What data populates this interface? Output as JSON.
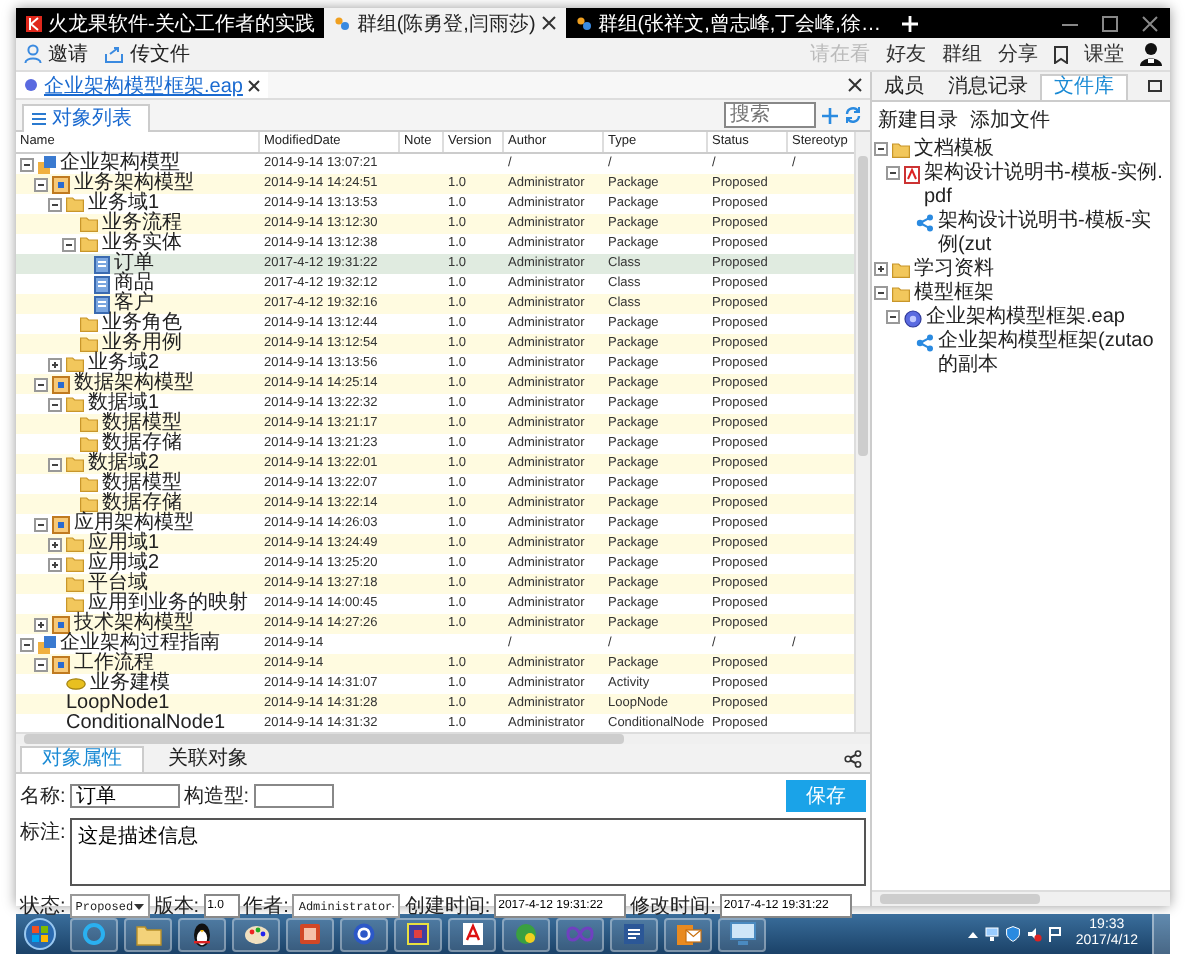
{
  "title_bar": {
    "tabs": [
      {
        "label": "火龙果软件-关心工作者的实践",
        "selected": false
      },
      {
        "label": "群组(陈勇登,闫雨莎)",
        "selected": true
      },
      {
        "label": "群组(张祥文,曾志峰,丁会峰,徐…",
        "selected": false
      }
    ]
  },
  "toolbar": {
    "left": [
      {
        "label": "邀请",
        "kind": "invite"
      },
      {
        "label": "传文件",
        "kind": "upload"
      }
    ],
    "right": [
      {
        "label": "请在看",
        "disabled": true
      },
      {
        "label": "好友",
        "disabled": false
      },
      {
        "label": "群组",
        "disabled": false
      },
      {
        "label": "分享",
        "disabled": false
      },
      {
        "label": "课堂",
        "disabled": false
      }
    ]
  },
  "document_tab": {
    "label": "企业架构模型框架.eap"
  },
  "object_list": {
    "tab": "对象列表",
    "search": {
      "placeholder": "搜索"
    },
    "columns": [
      "Name",
      "ModifiedDate",
      "Note",
      "Version",
      "Author",
      "Type",
      "Status",
      "Stereotyp"
    ],
    "rows": [
      {
        "name": "企业架构模型",
        "kind": "model",
        "modified": "2014-9-14 13:07:21",
        "author": "/",
        "type": "/",
        "status": "/",
        "stereotype": "/",
        "expanded": true,
        "selected": false,
        "children": [
          {
            "name": "业务架构模型",
            "kind": "package",
            "modified": "2014-9-14 14:24:51",
            "version": "1.0",
            "author": "Administrator",
            "type": "Package",
            "status": "Proposed",
            "expanded": true,
            "selected": false,
            "children": [
              {
                "name": "业务域1",
                "kind": "folder",
                "modified": "2014-9-14 13:13:53",
                "version": "1.0",
                "author": "Administrator",
                "type": "Package",
                "status": "Proposed",
                "expanded": true,
                "selected": false,
                "children": [
                  {
                    "name": "业务流程",
                    "kind": "folder",
                    "modified": "2014-9-14 13:12:30",
                    "version": "1.0",
                    "author": "Administrator",
                    "type": "Package",
                    "status": "Proposed",
                    "selected": false
                  },
                  {
                    "name": "业务实体",
                    "kind": "folder",
                    "modified": "2014-9-14 13:12:38",
                    "version": "1.0",
                    "author": "Administrator",
                    "type": "Package",
                    "status": "Proposed",
                    "expanded": true,
                    "selected": false,
                    "children": [
                      {
                        "name": "订单",
                        "kind": "class",
                        "modified": "2017-4-12 19:31:22",
                        "version": "1.0",
                        "author": "Administrator",
                        "type": "Class",
                        "status": "Proposed",
                        "selected": true
                      },
                      {
                        "name": "商品",
                        "kind": "class",
                        "modified": "2017-4-12 19:32:12",
                        "version": "1.0",
                        "author": "Administrator",
                        "type": "Class",
                        "status": "Proposed",
                        "selected": false
                      },
                      {
                        "name": "客户",
                        "kind": "class",
                        "modified": "2017-4-12 19:32:16",
                        "version": "1.0",
                        "author": "Administrator",
                        "type": "Class",
                        "status": "Proposed",
                        "selected": false
                      }
                    ]
                  },
                  {
                    "name": "业务角色",
                    "kind": "folder",
                    "modified": "2014-9-14 13:12:44",
                    "version": "1.0",
                    "author": "Administrator",
                    "type": "Package",
                    "status": "Proposed",
                    "selected": false
                  },
                  {
                    "name": "业务用例",
                    "kind": "folder",
                    "modified": "2014-9-14 13:12:54",
                    "version": "1.0",
                    "author": "Administrator",
                    "type": "Package",
                    "status": "Proposed",
                    "selected": false
                  }
                ]
              },
              {
                "name": "业务域2",
                "kind": "folder",
                "modified": "2014-9-14 13:13:56",
                "version": "1.0",
                "author": "Administrator",
                "type": "Package",
                "status": "Proposed",
                "expanded": false,
                "selected": false
              }
            ]
          },
          {
            "name": "数据架构模型",
            "kind": "package",
            "modified": "2014-9-14 14:25:14",
            "version": "1.0",
            "author": "Administrator",
            "type": "Package",
            "status": "Proposed",
            "expanded": true,
            "selected": false,
            "children": [
              {
                "name": "数据域1",
                "kind": "folder",
                "modified": "2014-9-14 13:22:32",
                "version": "1.0",
                "author": "Administrator",
                "type": "Package",
                "status": "Proposed",
                "expanded": true,
                "selected": false,
                "children": [
                  {
                    "name": "数据模型",
                    "kind": "folder",
                    "modified": "2014-9-14 13:21:17",
                    "version": "1.0",
                    "author": "Administrator",
                    "type": "Package",
                    "status": "Proposed",
                    "selected": false
                  },
                  {
                    "name": "数据存储",
                    "kind": "folder",
                    "modified": "2014-9-14 13:21:23",
                    "version": "1.0",
                    "author": "Administrator",
                    "type": "Package",
                    "status": "Proposed",
                    "selected": false
                  }
                ]
              },
              {
                "name": "数据域2",
                "kind": "folder",
                "modified": "2014-9-14 13:22:01",
                "version": "1.0",
                "author": "Administrator",
                "type": "Package",
                "status": "Proposed",
                "expanded": true,
                "selected": false,
                "children": [
                  {
                    "name": "数据模型",
                    "kind": "folder",
                    "modified": "2014-9-14 13:22:07",
                    "version": "1.0",
                    "author": "Administrator",
                    "type": "Package",
                    "status": "Proposed",
                    "selected": false
                  },
                  {
                    "name": "数据存储",
                    "kind": "folder",
                    "modified": "2014-9-14 13:22:14",
                    "version": "1.0",
                    "author": "Administrator",
                    "type": "Package",
                    "status": "Proposed",
                    "selected": false
                  }
                ]
              }
            ]
          },
          {
            "name": "应用架构模型",
            "kind": "package",
            "modified": "2014-9-14 14:26:03",
            "version": "1.0",
            "author": "Administrator",
            "type": "Package",
            "status": "Proposed",
            "expanded": true,
            "selected": false,
            "children": [
              {
                "name": "应用域1",
                "kind": "folder",
                "modified": "2014-9-14 13:24:49",
                "version": "1.0",
                "author": "Administrator",
                "type": "Package",
                "status": "Proposed",
                "expanded": false,
                "selected": false
              },
              {
                "name": "应用域2",
                "kind": "folder",
                "modified": "2014-9-14 13:25:20",
                "version": "1.0",
                "author": "Administrator",
                "type": "Package",
                "status": "Proposed",
                "expanded": false,
                "selected": false
              },
              {
                "name": "平台域",
                "kind": "folder",
                "modified": "2014-9-14 13:27:18",
                "version": "1.0",
                "author": "Administrator",
                "type": "Package",
                "status": "Proposed",
                "selected": false
              },
              {
                "name": "应用到业务的映射",
                "kind": "folder",
                "modified": "2014-9-14 14:00:45",
                "version": "1.0",
                "author": "Administrator",
                "type": "Package",
                "status": "Proposed",
                "selected": false
              }
            ]
          },
          {
            "name": "技术架构模型",
            "kind": "package",
            "modified": "2014-9-14 14:27:26",
            "version": "1.0",
            "author": "Administrator",
            "type": "Package",
            "status": "Proposed",
            "expanded": false,
            "selected": false
          }
        ]
      },
      {
        "name": "企业架构过程指南",
        "kind": "model",
        "modified": "2014-9-14",
        "author": "/",
        "type": "/",
        "status": "/",
        "stereotype": "/",
        "expanded": true,
        "selected": false,
        "children": [
          {
            "name": "工作流程",
            "kind": "package",
            "modified": "2014-9-14",
            "version": "1.0",
            "author": "Administrator",
            "type": "Package",
            "status": "Proposed",
            "expanded": true,
            "selected": false,
            "children": [
              {
                "name": "业务建模",
                "kind": "activity",
                "modified": "2014-9-14 14:31:07",
                "version": "1.0",
                "author": "Administrator",
                "type": "Activity",
                "status": "Proposed",
                "selected": false
              },
              {
                "name": "LoopNode1",
                "kind": "node",
                "modified": "2014-9-14 14:31:28",
                "version": "1.0",
                "author": "Administrator",
                "type": "LoopNode",
                "status": "Proposed",
                "selected": false
              },
              {
                "name": "ConditionalNode1",
                "kind": "node",
                "modified": "2014-9-14 14:31:32",
                "version": "1.0",
                "author": "Administrator",
                "type": "ConditionalNode",
                "status": "Proposed",
                "selected": false
              }
            ]
          }
        ]
      }
    ]
  },
  "properties": {
    "tabs": [
      {
        "label": "对象属性",
        "selected": true
      },
      {
        "label": "关联对象",
        "selected": false
      }
    ],
    "name_label": "名称:",
    "name": "订单",
    "stereotype_label": "构造型:",
    "save": "保存",
    "note_label": "标注:",
    "note": "这是描述信息",
    "status_label": "状态:",
    "status": "Proposed",
    "version_label": "版本:",
    "version": "1.0",
    "author_label": "作者:",
    "author": "Administrator",
    "created_label": "创建时间:",
    "created": "2017-4-12 19:31:22",
    "modified_label": "修改时间:",
    "modified": "2017-4-12 19:31:22"
  },
  "file_panel": {
    "tabs": [
      {
        "label": "成员",
        "selected": false
      },
      {
        "label": "消息记录",
        "selected": false
      },
      {
        "label": "文件库",
        "selected": true
      }
    ],
    "actions": [
      "新建目录",
      "添加文件"
    ],
    "tree": [
      {
        "name": "文档模板",
        "kind": "folder",
        "expanded": true,
        "children": [
          {
            "name": "架构设计说明书-模板-实例.pdf",
            "kind": "pdf",
            "expanded": true,
            "children": [
              {
                "name": "架构设计说明书-模板-实例(zut",
                "kind": "share"
              }
            ]
          }
        ]
      },
      {
        "name": "学习资料",
        "kind": "folder",
        "expanded": false
      },
      {
        "name": "模型框架",
        "kind": "folder",
        "expanded": true,
        "children": [
          {
            "name": "企业架构模型框架.eap",
            "kind": "eap",
            "expanded": true,
            "children": [
              {
                "name": "企业架构模型框架(zutao的副本",
                "kind": "share"
              }
            ]
          }
        ]
      }
    ]
  },
  "taskbar": {
    "time": "19:33",
    "date": "2017/4/12"
  }
}
